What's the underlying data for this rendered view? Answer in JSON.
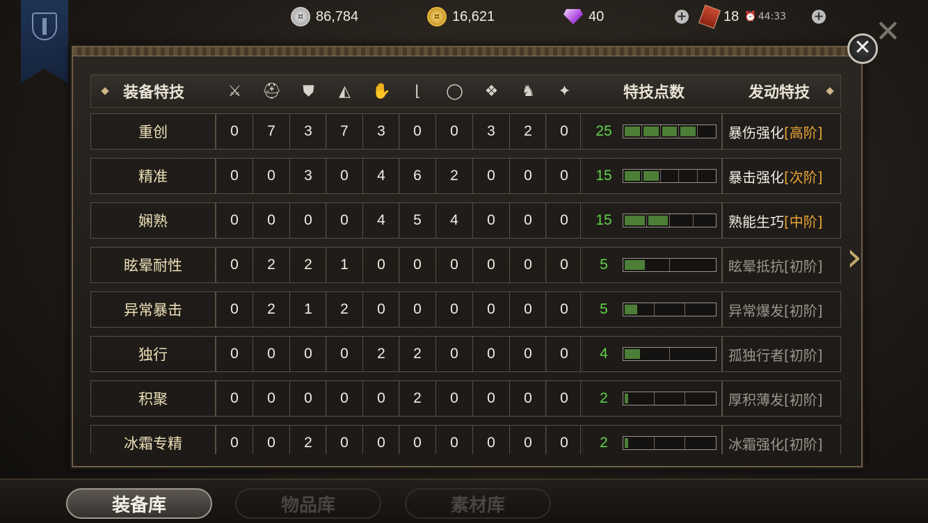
{
  "resources": {
    "silver": "86,784",
    "gold": "16,621",
    "gems": "40",
    "stamina": "18",
    "stamina_timer": "44:33"
  },
  "table": {
    "header_name": "装备特技",
    "header_points": "特技点数",
    "header_skill": "发动特技",
    "slot_icons": [
      "sword-icon",
      "helmet-icon",
      "chest-armor-icon",
      "shoulder-icon",
      "gauntlet-icon",
      "boots-icon",
      "ring-icon",
      "amulet-icon",
      "horse-icon",
      "accessory-icon"
    ],
    "rows": [
      {
        "name": "重创",
        "values": [
          "0",
          "7",
          "3",
          "7",
          "3",
          "0",
          "0",
          "3",
          "2",
          "0"
        ],
        "points": "25",
        "fill": [
          1,
          1,
          1,
          1,
          0
        ],
        "skill": "暴伤强化",
        "tier": "[高阶]",
        "active": true
      },
      {
        "name": "精准",
        "values": [
          "0",
          "0",
          "3",
          "0",
          "4",
          "6",
          "2",
          "0",
          "0",
          "0"
        ],
        "points": "15",
        "fill": [
          1,
          1,
          0,
          0,
          0
        ],
        "skill": "暴击强化",
        "tier": "[次阶]",
        "active": true
      },
      {
        "name": "娴熟",
        "values": [
          "0",
          "0",
          "0",
          "0",
          "4",
          "5",
          "4",
          "0",
          "0",
          "0"
        ],
        "points": "15",
        "fill": [
          1,
          1,
          0,
          0
        ],
        "skill": "熟能生巧",
        "tier": "[中阶]",
        "active": true
      },
      {
        "name": "眩晕耐性",
        "values": [
          "0",
          "2",
          "2",
          "1",
          "0",
          "0",
          "0",
          "0",
          "0",
          "0"
        ],
        "points": "5",
        "fill": [
          0.5,
          0
        ],
        "skill": "眩晕抵抗",
        "tier": "[初阶]",
        "active": false
      },
      {
        "name": "异常暴击",
        "values": [
          "0",
          "2",
          "1",
          "2",
          "0",
          "0",
          "0",
          "0",
          "0",
          "0"
        ],
        "points": "5",
        "fill": [
          0.5,
          0,
          0
        ],
        "skill": "异常爆发",
        "tier": "[初阶]",
        "active": false
      },
      {
        "name": "独行",
        "values": [
          "0",
          "0",
          "0",
          "0",
          "2",
          "2",
          "0",
          "0",
          "0",
          "0"
        ],
        "points": "4",
        "fill": [
          0.4,
          0
        ],
        "skill": "孤独行者",
        "tier": "[初阶]",
        "active": false
      },
      {
        "name": "积聚",
        "values": [
          "0",
          "0",
          "0",
          "0",
          "0",
          "2",
          "0",
          "0",
          "0",
          "0"
        ],
        "points": "2",
        "fill": [
          0.2,
          0,
          0
        ],
        "skill": "厚积薄发",
        "tier": "[初阶]",
        "active": false
      },
      {
        "name": "冰霜专精",
        "values": [
          "0",
          "0",
          "2",
          "0",
          "0",
          "0",
          "0",
          "0",
          "0",
          "0"
        ],
        "points": "2",
        "fill": [
          0.2,
          0,
          0
        ],
        "skill": "冰霜强化",
        "tier": "[初阶]",
        "active": false
      }
    ]
  },
  "tabs": [
    {
      "label": "装备库",
      "active": true
    },
    {
      "label": "物品库",
      "active": false
    },
    {
      "label": "素材库",
      "active": false
    }
  ],
  "colors": {
    "points_green": "#5fd44a",
    "tier_orange": "#e8a436",
    "bar_fill": "#4c7e38"
  }
}
